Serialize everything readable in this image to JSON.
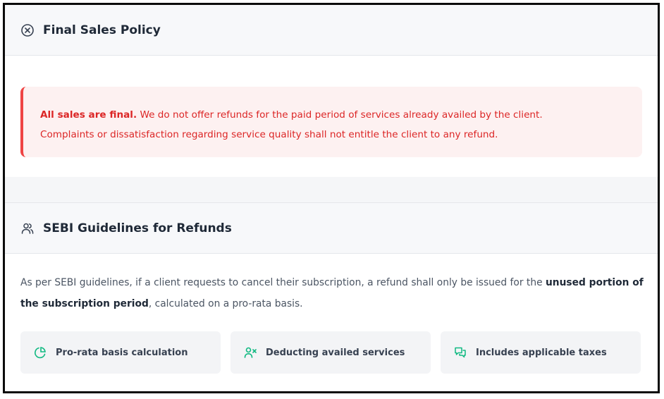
{
  "final_sales": {
    "title": "Final Sales Policy",
    "icon": "circle-x-icon",
    "alert_strong": "All sales are final.",
    "alert_line1_rest": " We do not offer refunds for the paid period of services already availed by the client.",
    "alert_line2": "Complaints or dissatisfaction regarding service quality shall not entitle the client to any refund."
  },
  "sebi": {
    "title": "SEBI Guidelines for Refunds",
    "icon": "users-icon",
    "desc_part1": "As per SEBI guidelines, if a client requests to cancel their subscription, a refund shall only be issued for the ",
    "desc_strong": "unused portion of the subscription period",
    "desc_part2": ", calculated on a pro-rata basis.",
    "features": [
      {
        "label": "Pro-rata basis calculation",
        "icon": "pie-chart-icon"
      },
      {
        "label": "Deducting availed services",
        "icon": "user-x-icon"
      },
      {
        "label": "Includes applicable taxes",
        "icon": "messages-icon"
      }
    ]
  },
  "colors": {
    "alert_text": "#dc2626",
    "alert_bg": "#fdf1f1",
    "alert_border": "#ef4444",
    "feature_icon": "#10b981"
  }
}
